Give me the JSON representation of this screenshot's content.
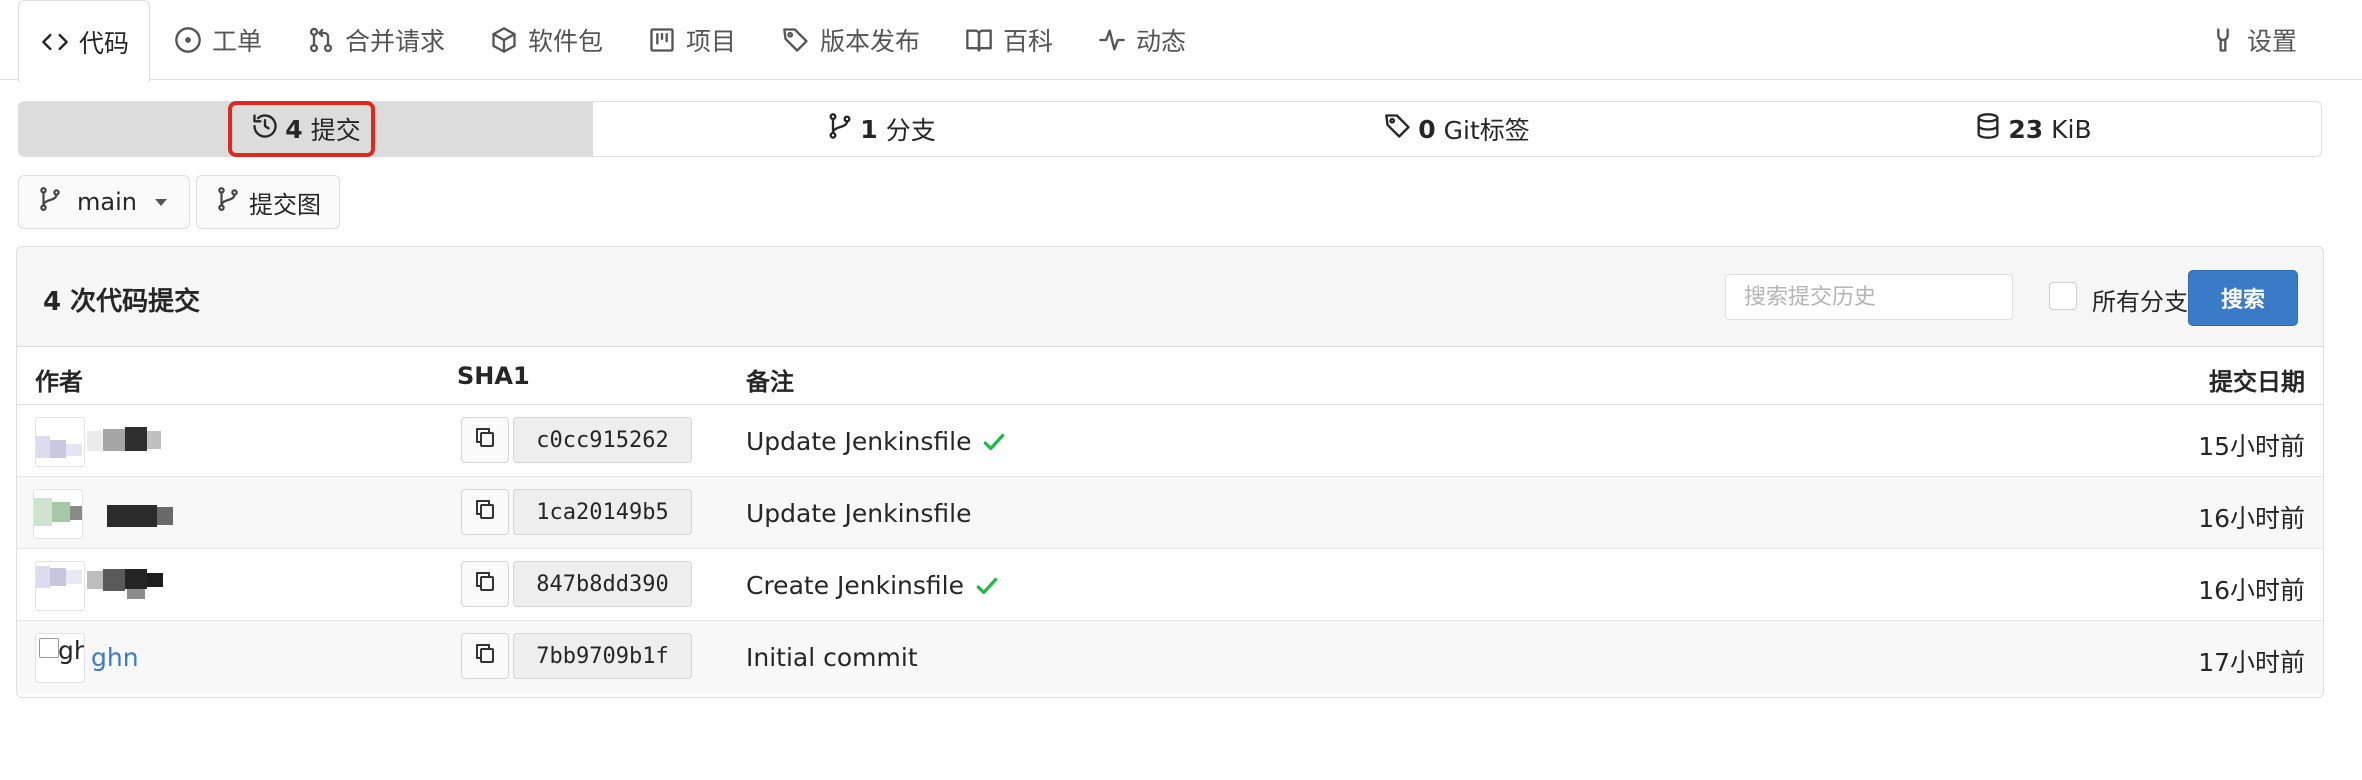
{
  "tabs": [
    {
      "label": "代码",
      "icon": "code-icon",
      "active": true
    },
    {
      "label": "工单",
      "icon": "issue-icon"
    },
    {
      "label": "合并请求",
      "icon": "pull-request-icon"
    },
    {
      "label": "软件包",
      "icon": "package-icon"
    },
    {
      "label": "项目",
      "icon": "project-icon"
    },
    {
      "label": "版本发布",
      "icon": "tag-icon"
    },
    {
      "label": "百科",
      "icon": "book-icon"
    },
    {
      "label": "动态",
      "icon": "pulse-icon"
    },
    {
      "label": "设置",
      "icon": "tool-icon"
    }
  ],
  "stats": {
    "commits": {
      "count": "4",
      "label": "提交"
    },
    "branches": {
      "count": "1",
      "label": "分支"
    },
    "tags": {
      "count": "0",
      "label": "Git标签"
    },
    "size": {
      "count": "23",
      "label": "KiB"
    }
  },
  "branch_selector": {
    "label": "main"
  },
  "commit_graph": {
    "label": "提交图"
  },
  "commits_header": {
    "title": "4 次代码提交",
    "search_placeholder": "搜索提交历史",
    "all_branches_label": "所有分支",
    "search_button": "搜索"
  },
  "columns": {
    "author": "作者",
    "sha": "SHA1",
    "message": "备注",
    "date": "提交日期"
  },
  "commits": [
    {
      "author": "",
      "sha": "c0cc915262",
      "message": "Update Jenkinsfile",
      "verified": true,
      "time": "15小时前"
    },
    {
      "author": "",
      "sha": "1ca20149b5",
      "message": "Update Jenkinsfile",
      "verified": false,
      "time": "16小时前"
    },
    {
      "author": "",
      "sha": "847b8dd390",
      "message": "Create Jenkinsfile",
      "verified": true,
      "time": "16小时前"
    },
    {
      "author": "ghn",
      "avatar_alt": "gh",
      "sha": "7bb9709b1f",
      "message": "Initial commit",
      "verified": false,
      "time": "17小时前"
    }
  ],
  "colors": {
    "accent": "#3a7bc8",
    "highlight": "#e0291c",
    "success": "#21ba45"
  }
}
